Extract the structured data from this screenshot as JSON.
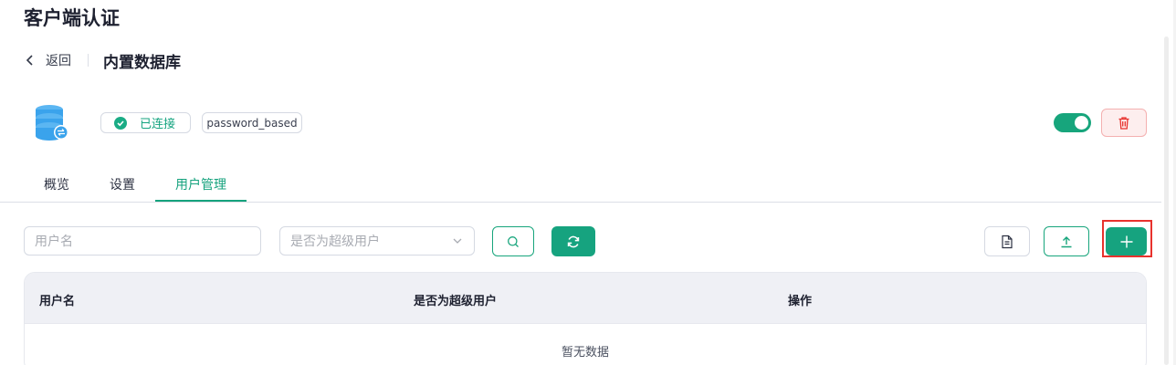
{
  "page": {
    "title": "客户端认证"
  },
  "subheader": {
    "back_label": "返回",
    "title": "内置数据库"
  },
  "status": {
    "connected_label": "已连接",
    "type_label": "password_based"
  },
  "tabs": [
    {
      "label": "概览"
    },
    {
      "label": "设置"
    },
    {
      "label": "用户管理",
      "active": true
    }
  ],
  "filters": {
    "username_placeholder": "用户名",
    "superuser_placeholder": "是否为超级用户"
  },
  "table": {
    "columns": [
      "用户名",
      "是否为超级用户",
      "操作"
    ],
    "empty_text": "暂无数据"
  },
  "icons": {
    "back": "chevron-left-icon",
    "database": "database-icon",
    "check": "check-circle-icon",
    "delete": "trash-icon",
    "search": "search-icon",
    "refresh": "refresh-icon",
    "document": "document-icon",
    "upload": "upload-icon",
    "add": "plus-icon",
    "dropdown": "chevron-down-icon"
  },
  "colors": {
    "accent": "#16a37f",
    "danger": "#e8322d",
    "highlight": "#e8322d"
  },
  "toggle": {
    "enabled": true
  }
}
